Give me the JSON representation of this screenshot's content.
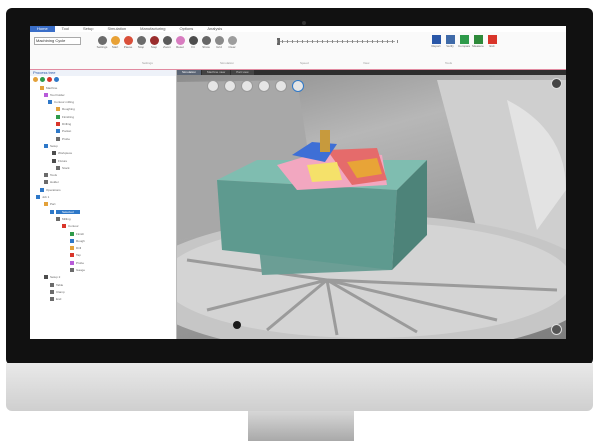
{
  "titlebar": {
    "tabs": [
      {
        "label": "Home",
        "active": true
      },
      {
        "label": "Tool"
      },
      {
        "label": "Setup"
      },
      {
        "label": "Simulation"
      },
      {
        "label": "Manufacturing"
      },
      {
        "label": "Options"
      },
      {
        "label": "Analysis"
      }
    ]
  },
  "ribbon": {
    "combo_value": "Machining Cycle",
    "buttons": [
      {
        "label": "Settings",
        "color": "#6b6b6b"
      },
      {
        "label": "Start",
        "color": "#e8a136"
      },
      {
        "label": "Pause",
        "color": "#d94f3a"
      },
      {
        "label": "Stop",
        "color": "#6b6b6b"
      },
      {
        "label": "Step",
        "color": "#9a2d2d"
      },
      {
        "label": "Zoom",
        "color": "#5a5a5a"
      },
      {
        "label": "Reset",
        "color": "#d87cc0"
      },
      {
        "label": "Fit",
        "color": "#4d4d4d"
      },
      {
        "label": "Show",
        "color": "#666666"
      },
      {
        "label": "Grid",
        "color": "#8a8a8a"
      },
      {
        "label": "Clear",
        "color": "#9d9d9d"
      }
    ],
    "groups": [
      "Settings",
      "Simulation",
      "Speed",
      "View",
      "Tools"
    ],
    "right_buttons": [
      {
        "label": "Report",
        "color": "#2a57a8"
      },
      {
        "label": "Verify",
        "color": "#3f6aa8"
      },
      {
        "label": "Compare",
        "color": "#2e9a4a"
      },
      {
        "label": "Measure",
        "color": "#2e8a3a"
      },
      {
        "label": "Exit",
        "color": "#d9352a"
      }
    ]
  },
  "left_panel": {
    "title": "Process tree",
    "rows": [
      {
        "label": "Machine",
        "indent": 10,
        "color": "#e3a13a"
      },
      {
        "label": "Tool holder",
        "indent": 14,
        "color": "#b85bd9"
      },
      {
        "label": "Contour milling",
        "indent": 18,
        "color": "#2e78c8"
      },
      {
        "label": "Roughing",
        "indent": 26,
        "color": "#e3a13a"
      },
      {
        "label": "Finishing",
        "indent": 26,
        "color": "#2e9a4a"
      },
      {
        "label": "Drilling",
        "indent": 26,
        "color": "#d9352a"
      },
      {
        "label": "Pocket",
        "indent": 26,
        "color": "#2e78c8"
      },
      {
        "label": "Probe",
        "indent": 26,
        "color": "#6b6b6b"
      },
      {
        "label": "Setup",
        "indent": 14,
        "color": "#2e78c8"
      },
      {
        "label": "Workpiece",
        "indent": 22,
        "color": "#4d4d4d"
      },
      {
        "label": "Fixture",
        "indent": 22,
        "color": "#4d4d4d"
      },
      {
        "label": "Stock",
        "indent": 26,
        "color": "#6b6b6b"
      },
      {
        "label": "Tools",
        "indent": 14,
        "color": "#6b6b6b"
      },
      {
        "label": "Holder",
        "indent": 14,
        "color": "#6b6b6b"
      },
      {
        "label": "Operations",
        "indent": 10,
        "color": "#2e78c8"
      },
      {
        "label": "Job 1",
        "indent": 6,
        "color": "#2e78c8"
      },
      {
        "label": "Part",
        "indent": 14,
        "color": "#e3a13a"
      },
      {
        "label": "Selected",
        "indent": 20,
        "color": "#2e78c8",
        "selected": true
      },
      {
        "label": "Milling",
        "indent": 26,
        "color": "#6b6b6b"
      },
      {
        "label": "Contour",
        "indent": 32,
        "color": "#d9352a"
      },
      {
        "label": "Finish",
        "indent": 40,
        "color": "#2e9a4a"
      },
      {
        "label": "Rough",
        "indent": 40,
        "color": "#2e78c8"
      },
      {
        "label": "Drill",
        "indent": 40,
        "color": "#e3a13a"
      },
      {
        "label": "Tap",
        "indent": 40,
        "color": "#d9352a"
      },
      {
        "label": "Probe",
        "indent": 40,
        "color": "#b85bd9"
      },
      {
        "label": "Gauge",
        "indent": 40,
        "color": "#6b6b6b"
      },
      {
        "label": "Setup 2",
        "indent": 14,
        "color": "#4d4d4d"
      },
      {
        "label": "Table",
        "indent": 20,
        "color": "#6b6b6b"
      },
      {
        "label": "Clamp",
        "indent": 20,
        "color": "#6b6b6b"
      },
      {
        "label": "End",
        "indent": 20,
        "color": "#6b6b6b"
      }
    ]
  },
  "viewport": {
    "tabs": [
      "Simulation",
      "Machine view",
      "Part view"
    ]
  }
}
